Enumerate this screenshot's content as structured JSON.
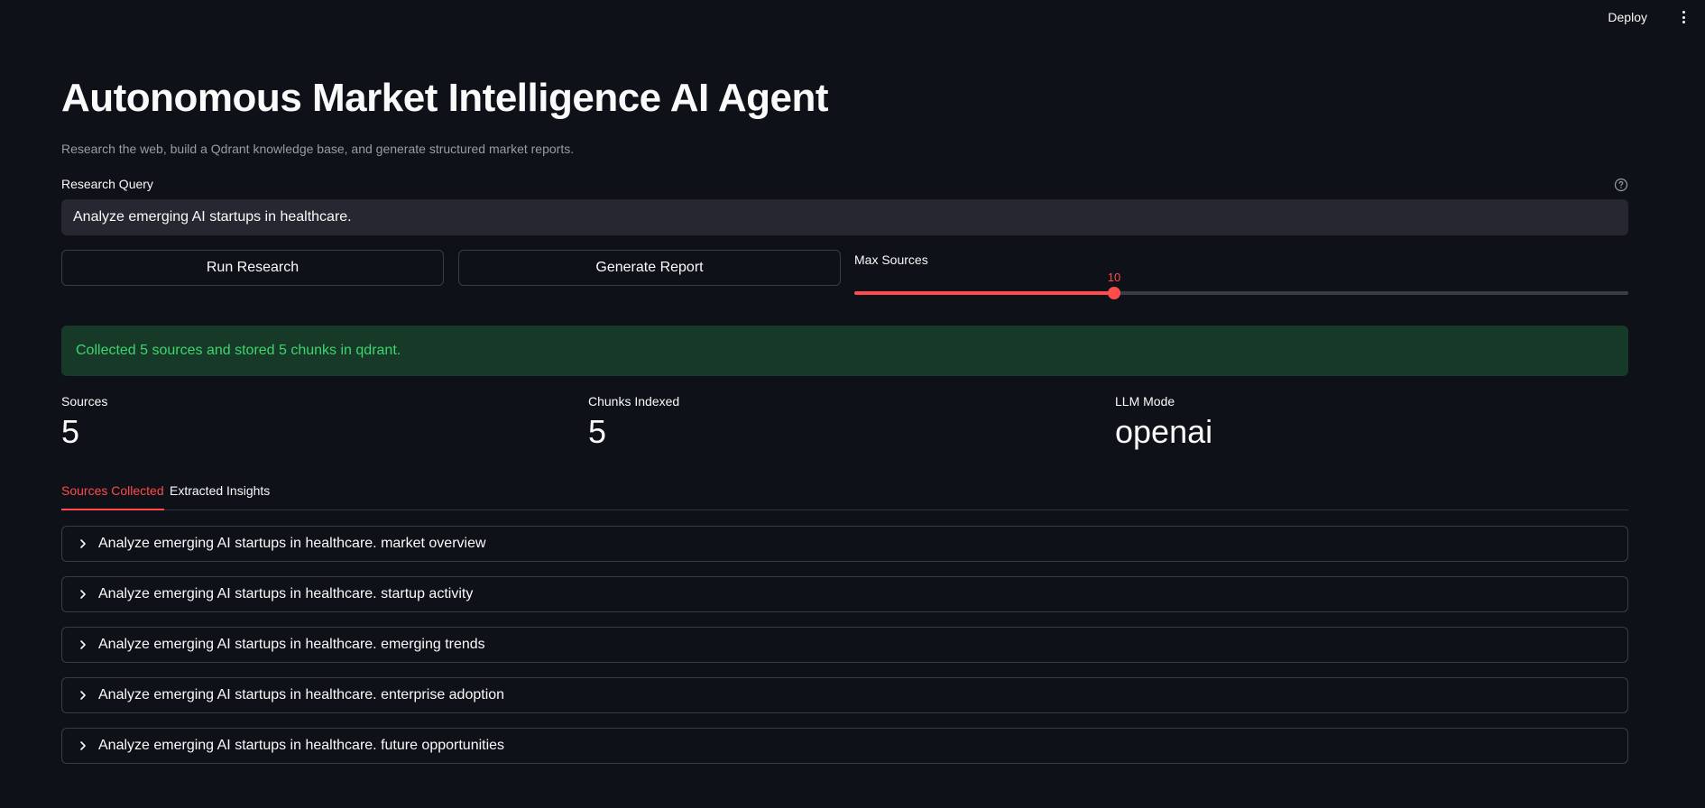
{
  "header": {
    "deploy_label": "Deploy",
    "menu_icon": "kebab-menu-icon"
  },
  "page": {
    "title": "Autonomous Market Intelligence AI Agent",
    "subtitle": "Research the web, build a Qdrant knowledge base, and generate structured market reports."
  },
  "query": {
    "label": "Research Query",
    "value": "Analyze emerging AI startups in healthcare.",
    "help_icon": "question-circle-icon"
  },
  "actions": {
    "run_label": "Run Research",
    "generate_label": "Generate Report"
  },
  "slider": {
    "label": "Max Sources",
    "value": "10",
    "fraction": 0.336
  },
  "status": {
    "message": "Collected 5 sources and stored 5 chunks in qdrant."
  },
  "metrics": [
    {
      "label": "Sources",
      "value": "5"
    },
    {
      "label": "Chunks Indexed",
      "value": "5"
    },
    {
      "label": "LLM Mode",
      "value": "openai"
    }
  ],
  "tabs": [
    {
      "label": "Sources Collected",
      "active": true
    },
    {
      "label": "Extracted Insights",
      "active": false
    }
  ],
  "sources": [
    "Analyze emerging AI startups in healthcare. market overview",
    "Analyze emerging AI startups in healthcare. startup activity",
    "Analyze emerging AI startups in healthcare. emerging trends",
    "Analyze emerging AI startups in healthcare. enterprise adoption",
    "Analyze emerging AI startups in healthcare. future opportunities"
  ],
  "colors": {
    "background": "#0e1117",
    "accent": "#ff4b4b",
    "success_bg": "#173928",
    "success_text": "#3dd56d"
  }
}
